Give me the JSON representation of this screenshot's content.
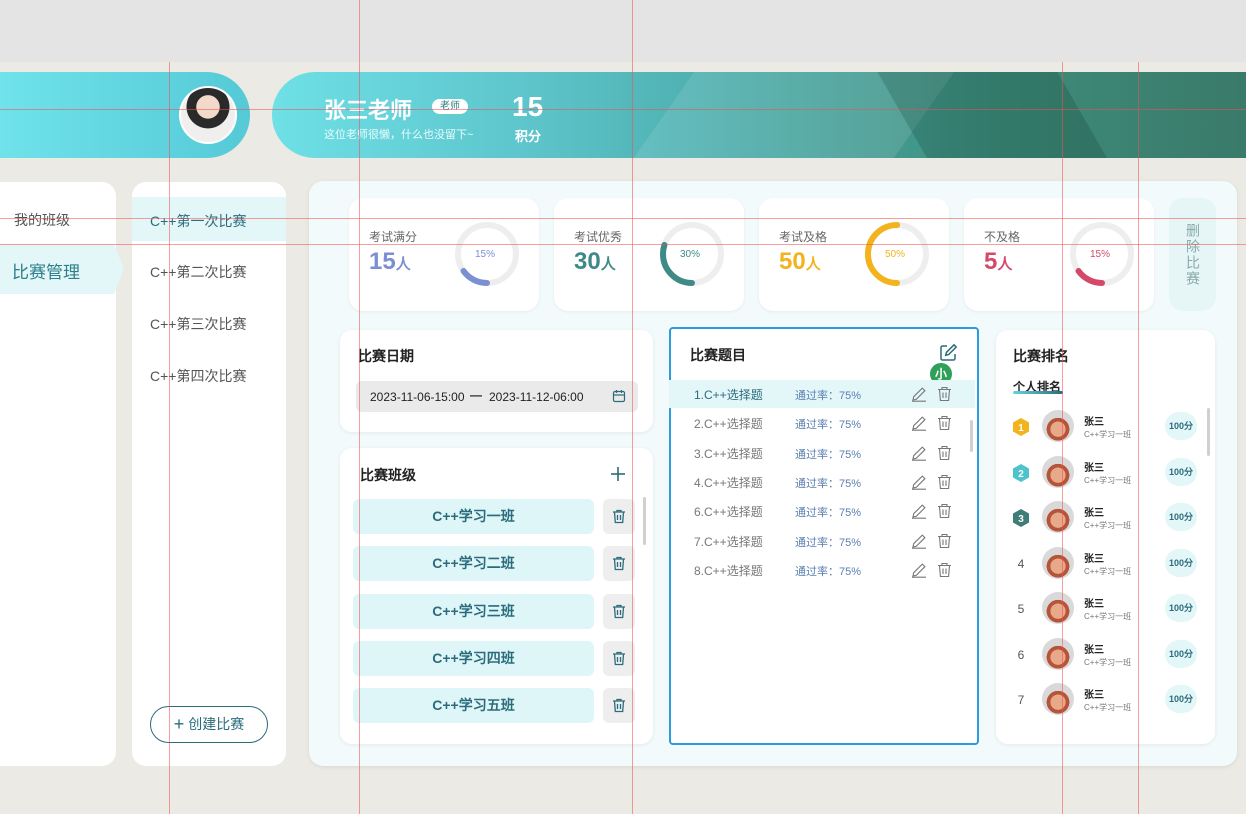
{
  "profile": {
    "name": "张三老师",
    "tag": "老师",
    "motto": "这位老师很懒，什么也没留下~",
    "score": "15",
    "score_label": "积分"
  },
  "nav": {
    "items": [
      {
        "label": "我的班级"
      },
      {
        "label": "比赛管理"
      }
    ]
  },
  "competitions": {
    "items": [
      {
        "label": "C++第一次比赛"
      },
      {
        "label": "C++第二次比赛"
      },
      {
        "label": "C++第三次比赛"
      },
      {
        "label": "C++第四次比赛"
      }
    ],
    "create_label": "创建比赛"
  },
  "stats": [
    {
      "label": "考试满分",
      "value": "15",
      "unit": "人",
      "percent": "15%",
      "fraction": 0.15,
      "color": "#7b8fd3"
    },
    {
      "label": "考试优秀",
      "value": "30",
      "unit": "人",
      "percent": "30%",
      "fraction": 0.3,
      "color": "#3e8a86"
    },
    {
      "label": "考试及格",
      "value": "50",
      "unit": "人",
      "percent": "50%",
      "fraction": 0.5,
      "color": "#f2b31d"
    },
    {
      "label": "不及格",
      "value": "5",
      "unit": "人",
      "percent": "15%",
      "fraction": 0.15,
      "color": "#d4496a"
    }
  ],
  "delete_competition_label": "删除比赛",
  "date_panel": {
    "title": "比赛日期",
    "start": "2023-11-06-15:00",
    "separator": "—",
    "end": "2023-11-12-06:00"
  },
  "class_panel": {
    "title": "比赛班级",
    "classes": [
      "C++学习一班",
      "C++学习二班",
      "C++学习三班",
      "C++学习四班",
      "C++学习五班"
    ]
  },
  "question_panel": {
    "title": "比赛题目",
    "badge": "小",
    "questions": [
      {
        "name": "1.C++选择题",
        "rate": "通过率：75%"
      },
      {
        "name": "2.C++选择题",
        "rate": "通过率：75%"
      },
      {
        "name": "3.C++选择题",
        "rate": "通过率：75%"
      },
      {
        "name": "4.C++选择题",
        "rate": "通过率：75%"
      },
      {
        "name": "6.C++选择题",
        "rate": "通过率：75%"
      },
      {
        "name": "7.C++选择题",
        "rate": "通过率：75%"
      },
      {
        "name": "8.C++选择题",
        "rate": "通过率：75%"
      }
    ]
  },
  "rank_panel": {
    "title": "比赛排名",
    "subtitle": "个人排名",
    "entries": [
      {
        "rank": "1",
        "name": "张三",
        "class": "C++学习一班",
        "score": "100分",
        "medal_color": "#f2b31d"
      },
      {
        "rank": "2",
        "name": "张三",
        "class": "C++学习一班",
        "score": "100分",
        "medal_color": "#4fc3cc"
      },
      {
        "rank": "3",
        "name": "张三",
        "class": "C++学习一班",
        "score": "100分",
        "medal_color": "#3e7d78"
      },
      {
        "rank": "4",
        "name": "张三",
        "class": "C++学习一班",
        "score": "100分"
      },
      {
        "rank": "5",
        "name": "张三",
        "class": "C++学习一班",
        "score": "100分"
      },
      {
        "rank": "6",
        "name": "张三",
        "class": "C++学习一班",
        "score": "100分"
      },
      {
        "rank": "7",
        "name": "张三",
        "class": "C++学习一班",
        "score": "100分"
      }
    ]
  }
}
